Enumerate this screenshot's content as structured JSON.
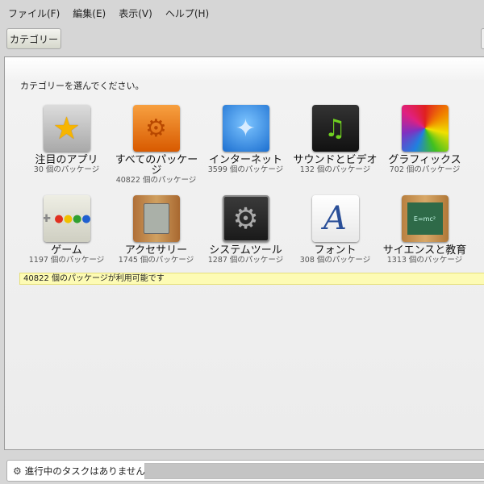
{
  "menu": [
    "ファイル(F)",
    "編集(E)",
    "表示(V)",
    "ヘルプ(H)"
  ],
  "toolbar": {
    "category_button": "カテゴリー"
  },
  "content": {
    "prompt": "カテゴリーを選んでください。",
    "categories": [
      {
        "label": "注目のアプリ",
        "count": "30 個のパッケージ",
        "icon": "star-icon"
      },
      {
        "label": "すべてのパッケージ",
        "count": "40822 個のパッケージ",
        "icon": "gears-icon"
      },
      {
        "label": "インターネット",
        "count": "3599 個のパッケージ",
        "icon": "globe-icon"
      },
      {
        "label": "サウンドとビデオ",
        "count": "132 個のパッケージ",
        "icon": "music-video-icon"
      },
      {
        "label": "グラフィックス",
        "count": "702 個のパッケージ",
        "icon": "color-wheel-icon"
      },
      {
        "label": "ゲーム",
        "count": "1197 個のパッケージ",
        "icon": "gamepad-icon"
      },
      {
        "label": "アクセサリー",
        "count": "1745 個のパッケージ",
        "icon": "calculator-icon"
      },
      {
        "label": "システムツール",
        "count": "1287 個のパッケージ",
        "icon": "system-gear-icon"
      },
      {
        "label": "フォント",
        "count": "308 個のパッケージ",
        "icon": "font-icon"
      },
      {
        "label": "サイエンスと教育",
        "count": "1313 個のパッケージ",
        "icon": "chalkboard-icon"
      }
    ],
    "status": "40822 個のパッケージが利用可能です"
  },
  "footer": {
    "task_status": "進行中のタスクはありません"
  }
}
